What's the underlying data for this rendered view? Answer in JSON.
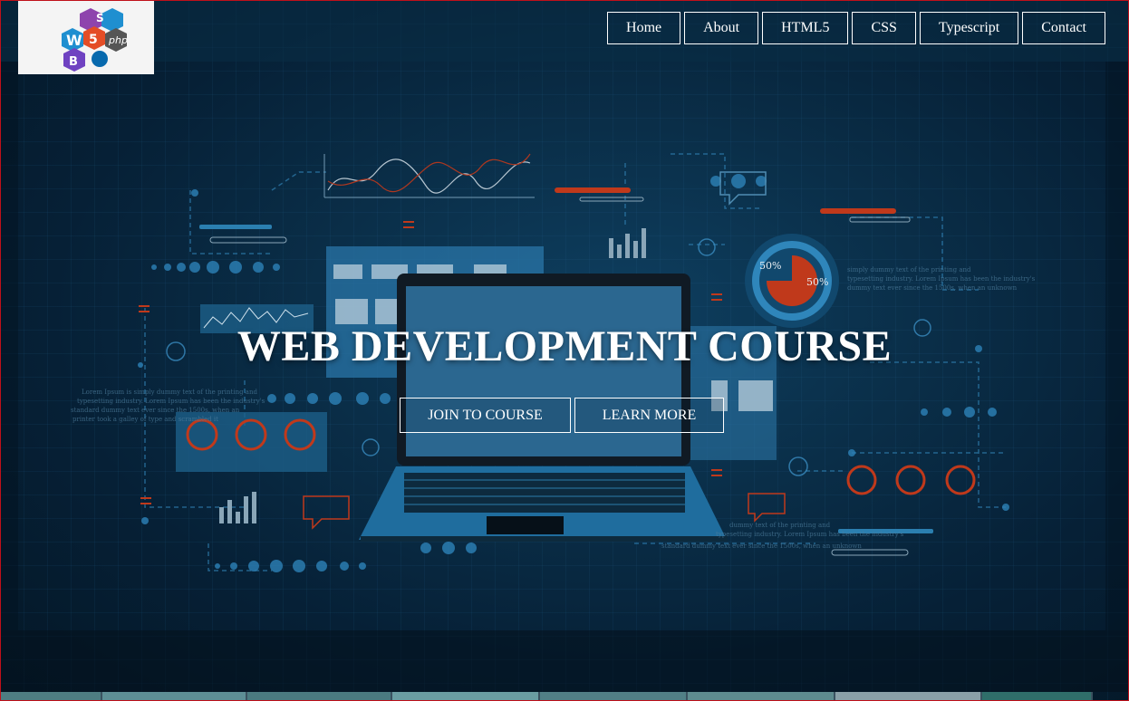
{
  "logo": {
    "alt": "Web technologies logo"
  },
  "nav": {
    "items": [
      {
        "label": "Home"
      },
      {
        "label": "About"
      },
      {
        "label": "HTML5"
      },
      {
        "label": "CSS"
      },
      {
        "label": "Typescript"
      },
      {
        "label": "Contact"
      }
    ]
  },
  "hero": {
    "title": "WEB DEVELOPMENT COURSE",
    "join_label": "JOIN TO COURSE",
    "learn_label": "LEARN MORE"
  },
  "colors": {
    "accent": "#ffffff",
    "background": "#062036",
    "frame": "#c0101a",
    "highlight_red": "#c0391b"
  }
}
